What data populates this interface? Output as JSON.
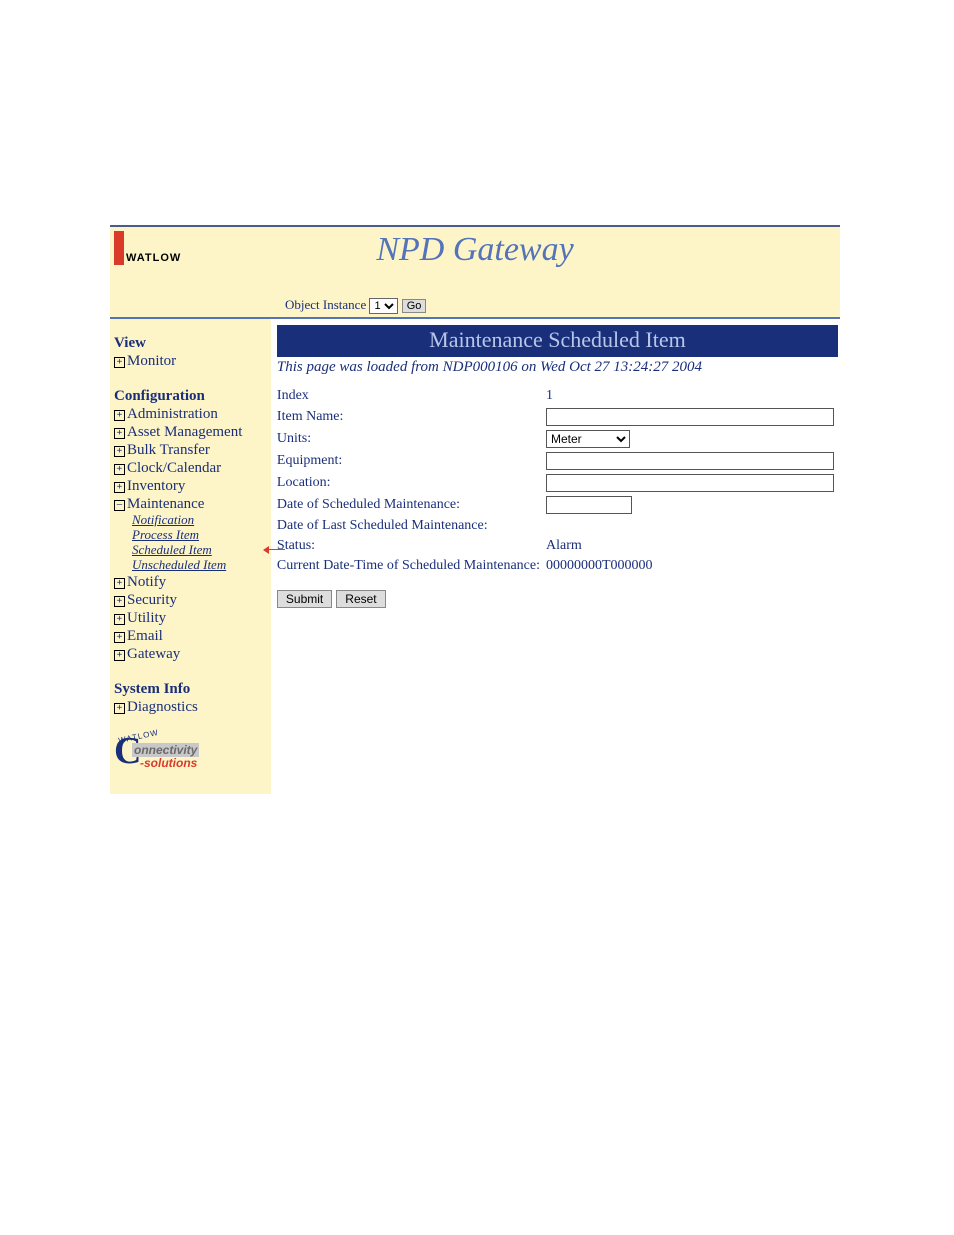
{
  "app": {
    "brand": "WATLOW",
    "title": "NPD Gateway",
    "object_instance_label": "Object Instance",
    "object_instance_value": "1",
    "go_label": "Go"
  },
  "sidebar": {
    "section_view": "View",
    "item_monitor": "Monitor",
    "section_config": "Configuration",
    "item_administration": "Administration",
    "item_asset": "Asset Management",
    "item_bulk": "Bulk Transfer",
    "item_clock": "Clock/Calendar",
    "item_inventory": "Inventory",
    "item_maintenance": "Maintenance",
    "sub_notification": "Notification",
    "sub_process_item": "Process Item",
    "sub_scheduled_item": "Scheduled Item",
    "sub_unscheduled_item": "Unscheduled Item",
    "item_notify": "Notify",
    "item_security": "Security",
    "item_utility": "Utility",
    "item_email": "Email",
    "item_gateway": "Gateway",
    "section_system": "System Info",
    "item_diagnostics": "Diagnostics",
    "conn_arc": "WATLOW",
    "conn_word": "onnectivity",
    "conn_sol": "-solutions"
  },
  "main": {
    "page_title": "Maintenance Scheduled Item",
    "loaded_line": "This page was loaded from NDP000106 on Wed Oct 27 13:24:27 2004",
    "labels": {
      "index": "Index",
      "item_name": "Item Name:",
      "units": "Units:",
      "equipment": "Equipment:",
      "location": "Location:",
      "date_sched": "Date of Scheduled Maintenance:",
      "date_last": "Date of Last Scheduled Maintenance:",
      "status": "Status:",
      "current_dt": "Current Date-Time of Scheduled Maintenance:"
    },
    "values": {
      "index": "1",
      "units_selected": "Meter",
      "status": "Alarm",
      "current_dt": "00000000T000000"
    },
    "buttons": {
      "submit": "Submit",
      "reset": "Reset"
    }
  }
}
